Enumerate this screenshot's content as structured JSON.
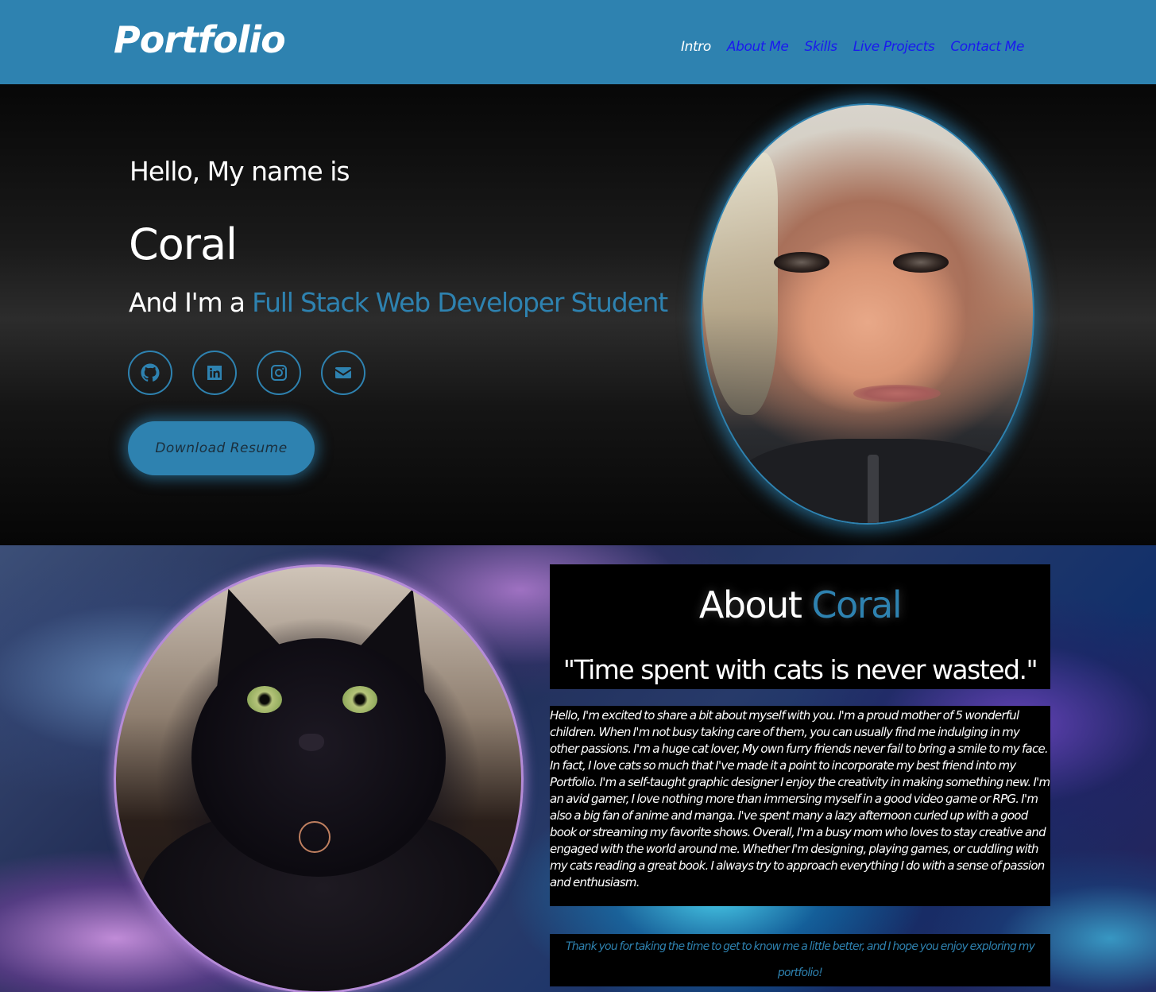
{
  "header": {
    "brand": "Portfolio",
    "nav": [
      {
        "label": "Intro",
        "active": true
      },
      {
        "label": "About Me",
        "active": false
      },
      {
        "label": "Skills",
        "active": false
      },
      {
        "label": "Live Projects",
        "active": false
      },
      {
        "label": "Contact Me",
        "active": false
      }
    ]
  },
  "hero": {
    "greeting": "Hello, My name is",
    "name": "Coral",
    "role_prefix": "And I'm a ",
    "role_highlight": "Full Stack Web Developer Student",
    "socials": [
      {
        "icon": "github-icon"
      },
      {
        "icon": "linkedin-icon"
      },
      {
        "icon": "instagram-icon"
      },
      {
        "icon": "email-icon"
      }
    ],
    "resume_button": "Download Resume"
  },
  "about": {
    "title_prefix": "About ",
    "title_highlight": "Coral",
    "quote": "\"Time spent with cats is never wasted.\"",
    "body": "Hello, I'm excited to share a bit about myself with you. I'm a proud mother of 5 wonderful children. When I'm not busy taking care of them, you can usually find me indulging in my other passions. I'm a huge cat lover, My own furry friends never fail to bring a smile to my face. In fact, I love cats so much that I've made it a point to incorporate my best friend into my Portfolio. I'm a self-taught graphic designer I enjoy the creativity in making something new. I'm an avid gamer, I love nothing more than immersing myself in a good video game or RPG. I'm also a big fan of anime and manga. I've spent many a lazy afternoon curled up with a good book or streaming my favorite shows. Overall, I'm a busy mom who loves to stay creative and engaged with the world around me. Whether I'm designing, playing games, or cuddling with my cats reading a great book. I always try to approach everything I do with a sense of passion and enthusiasm.",
    "thanks": "Thank you for taking the time to get to know me a little better, and I hope you enjoy exploring my portfolio!"
  },
  "colors": {
    "accent": "#2e82b0",
    "nav_link": "#1a1aee",
    "header_bg": "#2e82b0"
  }
}
